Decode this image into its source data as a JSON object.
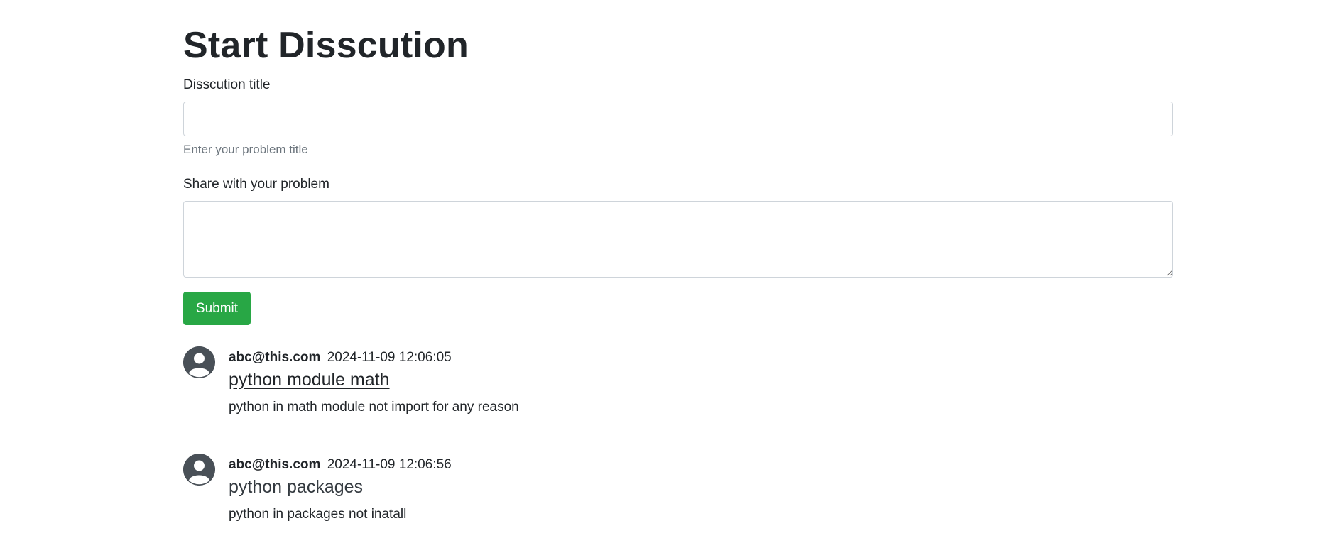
{
  "form": {
    "heading": "Start Disscution",
    "title_label": "Disscution title",
    "title_value": "",
    "title_help": "Enter your problem title",
    "desc_label": "Share with your problem",
    "desc_value": "",
    "submit_label": "Submit",
    "submit_color": "#28a745"
  },
  "discussions": [
    {
      "email": "abc@this.com",
      "timestamp": "2024-11-09 12:06:05",
      "title": "python module math",
      "description": "python in math module not import for any reason"
    },
    {
      "email": "abc@this.com",
      "timestamp": "2024-11-09 12:06:56",
      "title": "python packages",
      "description": "python in packages not inatall"
    }
  ],
  "icons": {
    "avatar": "user-avatar-icon"
  }
}
